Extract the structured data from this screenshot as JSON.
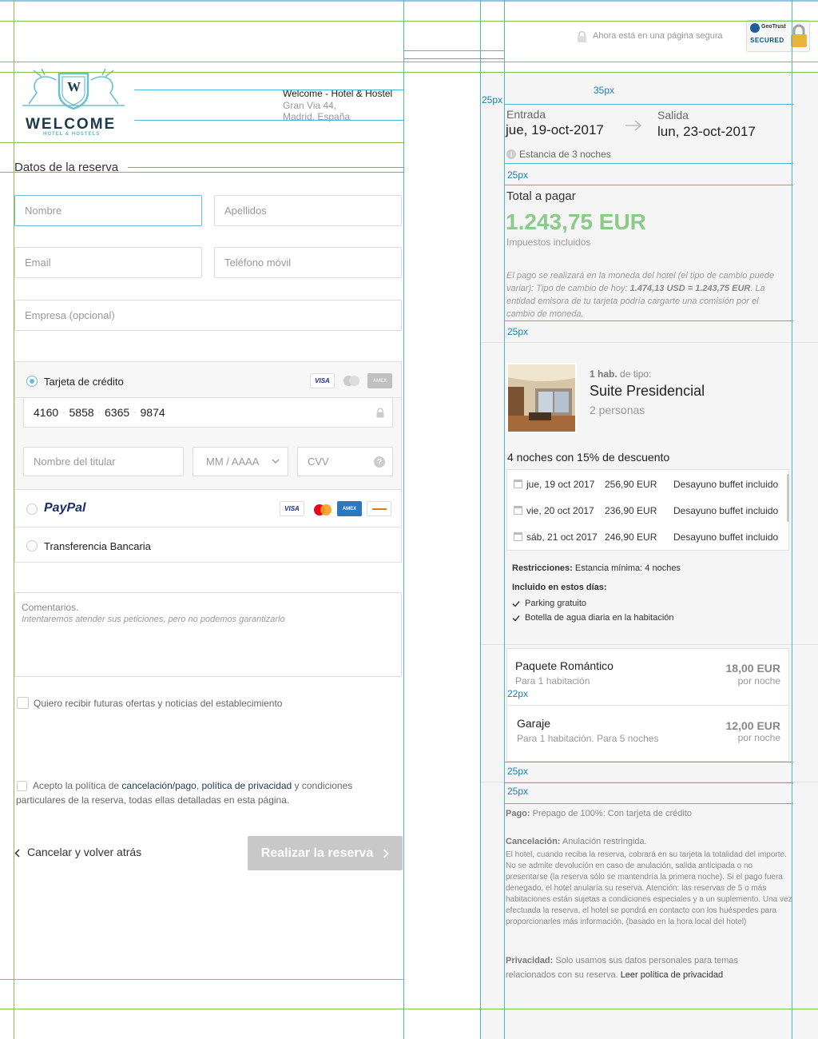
{
  "header": {
    "secure_text": "Ahora está en una página segura",
    "geotrust_brand": "GeoTrust",
    "geotrust_secured": "SECURED"
  },
  "logo": {
    "name": "WELCOME",
    "tagline": "HOTEL & HOSTELS",
    "monogram": "W"
  },
  "hotel": {
    "name": "Welcome - Hotel & Hostel",
    "address1": "Gran Via 44,",
    "address2": "Madrid, España"
  },
  "form": {
    "title": "Datos de la reserva",
    "first_name_ph": "Nombre",
    "last_name_ph": "Apellidos",
    "email_ph": "Email",
    "phone_ph": "Teléfono móvil",
    "company_ph": "Empresa (opcional)",
    "payment": {
      "card_label": "Tarjeta de crédito",
      "card_number": [
        "4160",
        "5858",
        "6365",
        "9874"
      ],
      "holder_ph": "Nombre del titular",
      "expiry_ph": "MM / AAAA",
      "cvv_ph": "CVV",
      "paypal_label": "PayPal",
      "transfer_label": "Transferencia Bancaria",
      "visa": "VISA",
      "amex": "AMEX"
    },
    "comments_label": "Comentarios.",
    "comments_ph": "Intentaremos atender sus peticiones, pero no podemos garantizarlo",
    "newsletter": "Quiero recibir futuras ofertas y noticias del establecimiento",
    "terms": {
      "prefix": "Acepto la política de ",
      "link1": "cancelación/pago",
      "sep": ", ",
      "link2": "política de privacidad",
      "suffix": " y condiciones",
      "line2": "particulares de la reserva, todas ellas detalladas en esta página."
    },
    "cancel_label": "Cancelar y volver atrás",
    "submit_label": "Realizar la reserva"
  },
  "guides": {
    "g35": "35px",
    "g25": "25px",
    "g22": "22px",
    "g25px": "25px"
  },
  "stay": {
    "checkin_label": "Entrada",
    "checkin_date": "jue, 19-oct-2017",
    "checkout_label": "Salida",
    "checkout_date": "lun, 23-oct-2017",
    "stay_prefix": "Estancia de ",
    "stay_nights": "3 noches"
  },
  "total": {
    "label": "Total a pagar",
    "amount": "1.243,75 EUR",
    "taxes": "Impuestos incluidos",
    "exchange_1": "El pago se realizará en la moneda del hotel (el tipo de cambio puede variar): Tipo de cambio de hoy: ",
    "exchange_rate": "1.474,13 USD = 1.243,75 EUR",
    "exchange_2": ". La entidad emisora de tu tarjeta podría cargarte una comisión por el cambio de moneda."
  },
  "room": {
    "count": "1 hab.",
    "type_suffix": " de tipo:",
    "name": "Suite Presidencial",
    "people": "2 personas",
    "offer": "4 noches con 15% de descuento",
    "nights": [
      {
        "date": "jue, 19 oct 2017",
        "price": "256,90 EUR",
        "board": "Desayuno buffet incluido"
      },
      {
        "date": "vie, 20 oct 2017",
        "price": "236,90 EUR",
        "board": "Desayuno buffet incluido"
      },
      {
        "date": "sáb, 21 oct 2017",
        "price": "246,90 EUR",
        "board": "Desayuno buffet incluido"
      }
    ],
    "restrictions_label": "Restricciones:",
    "restrictions_text": " Estancia mínima: 4 noches",
    "included_label": "Incluido en estos días:",
    "included": [
      "Parking gratuito",
      "Botella de agua diaria en la habitación"
    ]
  },
  "extras": [
    {
      "name": "Paquete Romántico",
      "detail": "Para 1 habitación",
      "price": "18,00 EUR",
      "unit": "por noche"
    },
    {
      "name": "Garaje",
      "detail": "Para 1 habitación. Para 5 noches",
      "price": "12,00 EUR",
      "unit": "por noche"
    }
  ],
  "policies": {
    "payment_label": "Pago:",
    "payment_text": " Prepago de 100%: Con tarjeta de crédito",
    "cancel_label": "Cancelación:",
    "cancel_text": " Anulación restringida.",
    "cancel_detail": "El hotel, cuando reciba la reserva, cobrará en su tarjeta la totalidad del importe. No se admite devolución en caso de anulación, salida anticipada o no presentarse (la reserva sólo se mantendría la primera noche). Si el pago fuera denegado, el hotel anularía su reserva. Atención: las reservas de 5 o más habitaciones están sujetas a condiciones especiales y a un suplemento. Una vez efectuada la reserva, el hotel se pondrá en contacto con los huéspedes para proporcionarles más información. (basado en la hora local del hotel)",
    "privacy_label": "Privacidad:",
    "privacy_text": " Solo usamos sus datos personales para temas relacionados con su reserva. ",
    "privacy_link": "Leer política de privacidad"
  },
  "colors": {
    "accent": "#6cbfcf",
    "total": "#8cc98a",
    "guide_green": "#8bc34a",
    "guide_blue": "#4fb3d9"
  }
}
